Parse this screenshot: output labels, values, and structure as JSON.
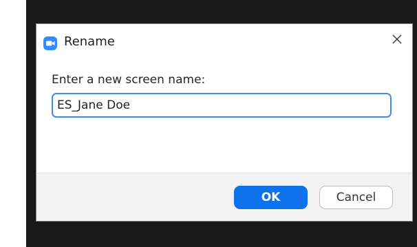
{
  "dialog": {
    "title": "Rename",
    "app_icon": "zoom-camera-icon",
    "close_icon": "close-icon",
    "prompt": "Enter a new screen name:",
    "name_value": "ES_Jane Doe",
    "ok_label": "OK",
    "cancel_label": "Cancel"
  },
  "colors": {
    "accent": "#0e72ed",
    "app_icon": "#2d8cff",
    "input_focus_border": "#3f8ce8",
    "footer_bg": "#f3f3f3"
  }
}
